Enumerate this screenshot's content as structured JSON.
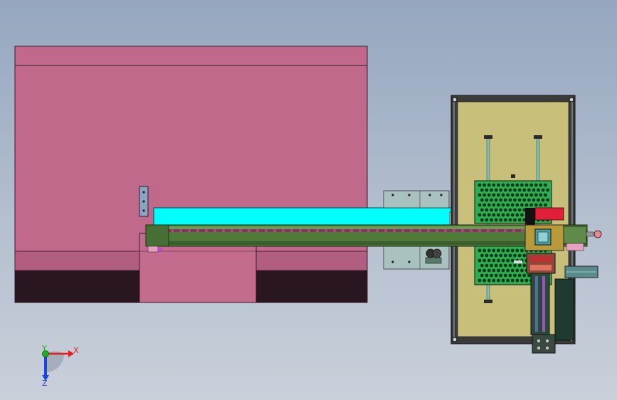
{
  "triad": {
    "x_label": "X",
    "y_label": "Y",
    "z_label": "Z"
  },
  "colors": {
    "background_top": "#95a6bf",
    "background_bottom": "#c9d0da",
    "cabinet": "#c0698b",
    "cabinet_dark": "#2a1620",
    "rail": "#4f7a3a",
    "highlight_bar": "#00ffff",
    "base_plate": "#c8c07a",
    "perforated_plate": "#2fae4f",
    "red_block": "#e0203a",
    "axis_x": "#e02020",
    "axis_y": "#20b020",
    "axis_z": "#2040e0"
  }
}
